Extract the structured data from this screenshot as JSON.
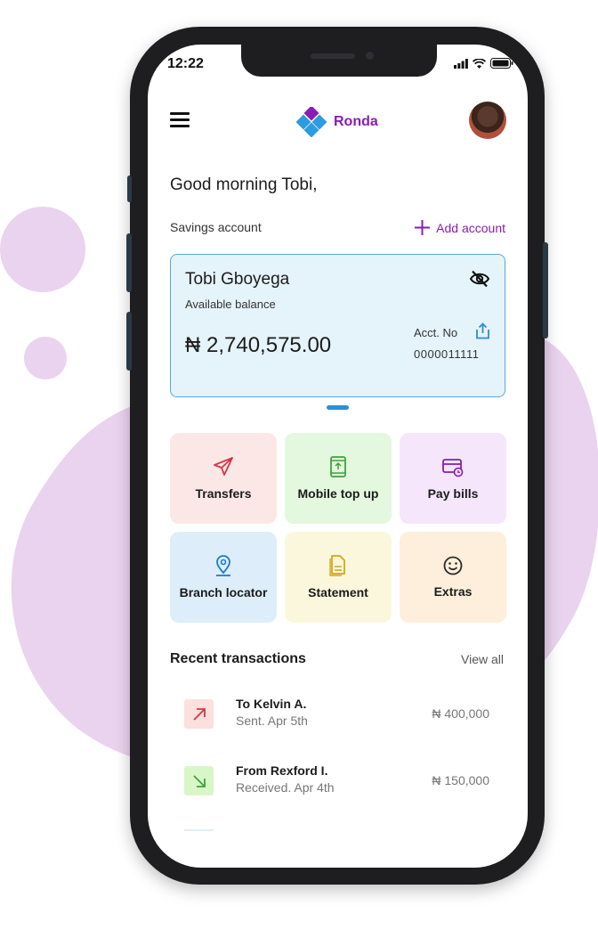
{
  "status": {
    "time": "12:22"
  },
  "brand": {
    "name": "Ronda",
    "icon": "diamond-logo-icon",
    "color": "#8a1bb3"
  },
  "greeting": "Good morning Tobi,",
  "account": {
    "type": "Savings account",
    "add_label": "Add account",
    "holder": "Tobi Gboyega",
    "balance_label": "Available balance",
    "balance": "₦ 2,740,575.00",
    "acct_label": "Acct. No",
    "acct_number": "0000011111"
  },
  "actions": [
    {
      "label": "Transfers",
      "icon": "send-icon",
      "bg": "#fbe8e6",
      "color": "#d6344a"
    },
    {
      "label": "Mobile top up",
      "icon": "phone-icon",
      "bg": "#e3f8de",
      "color": "#3fa33a"
    },
    {
      "label": "Pay bills",
      "icon": "bill-icon",
      "bg": "#f5e6fc",
      "color": "#8a1bb3"
    },
    {
      "label": "Branch locator",
      "icon": "location-pin-icon",
      "bg": "#ddeefa",
      "color": "#1f7ad0"
    },
    {
      "label": "Statement",
      "icon": "document-icon",
      "bg": "#fbf7dc",
      "color": "#d6a51b"
    },
    {
      "label": "Extras",
      "icon": "smiley-icon",
      "bg": "#fdefdc",
      "color": "#2b2b2b"
    }
  ],
  "transactions": {
    "title": "Recent transactions",
    "view_all": "View all",
    "items": [
      {
        "name": "To Kelvin A.",
        "detail": "Sent. Apr 5th",
        "amount": "₦ 400,000",
        "icon": "arrow-up-right-icon",
        "bg": "#fbe0dd",
        "color": "#d6344a"
      },
      {
        "name": "From Rexford I.",
        "detail": "Received. Apr 4th",
        "amount": "₦ 150,000",
        "icon": "arrow-down-right-icon",
        "bg": "#d9f6c9",
        "color": "#3fa33a"
      }
    ]
  }
}
